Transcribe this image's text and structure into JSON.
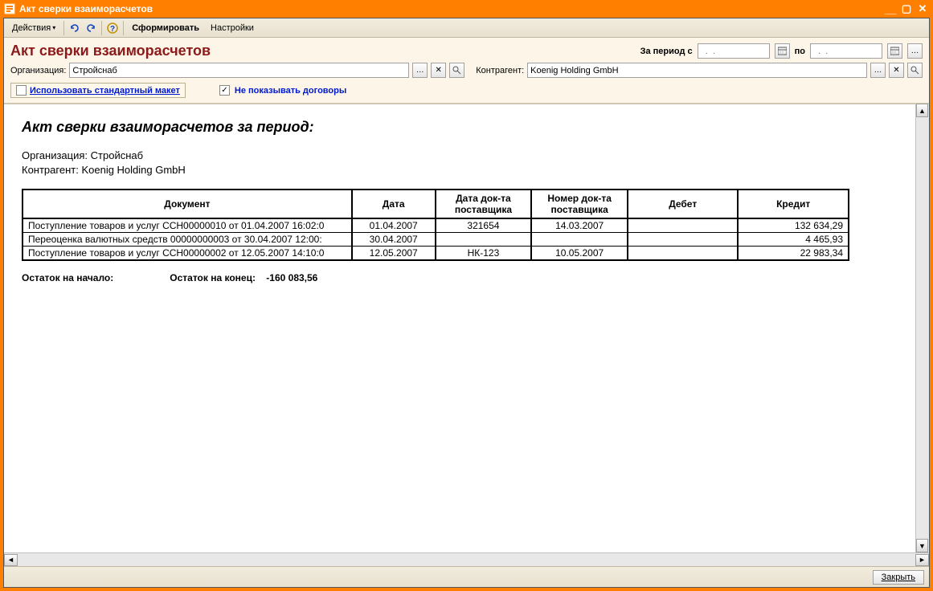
{
  "window": {
    "title": "Акт сверки взаиморасчетов"
  },
  "toolbar": {
    "actions": "Действия",
    "generate": "Сформировать",
    "settings": "Настройки"
  },
  "header": {
    "title": "Акт сверки взаиморасчетов",
    "period_label": "За период с",
    "to_label": "по",
    "date_from_placeholder": "  .  .    ",
    "date_to_placeholder": "  .  .    "
  },
  "filters": {
    "org_label": "Организация:",
    "org_value": "Стройснаб",
    "contr_label": "Контрагент:",
    "contr_value": "Koenig Holding GmbH",
    "use_std_layout_label": "Использовать стандартный макет",
    "use_std_layout_checked": false,
    "hide_contracts_label": "Не показывать договоры",
    "hide_contracts_checked": true
  },
  "report": {
    "title": "Акт сверки взаиморасчетов за период:",
    "org_line_label": "Организация:",
    "org_line_value": "Стройснаб",
    "contr_line_label": "Контрагент:",
    "contr_line_value": "Koenig Holding GmbH",
    "columns": {
      "document": "Документ",
      "date": "Дата",
      "sup_doc_date": "Дата док-та поставщика",
      "sup_doc_num": "Номер док-та поставщика",
      "debit": "Дебет",
      "credit": "Кредит"
    },
    "rows": [
      {
        "document": "Поступление товаров и услуг ССН00000010 от 01.04.2007 16:02:0",
        "date": "01.04.2007",
        "sup_date": "321654",
        "sup_num": "14.03.2007",
        "debit": "",
        "credit": "132 634,29"
      },
      {
        "document": "Переоценка валютных средств 00000000003 от 30.04.2007 12:00:",
        "date": "30.04.2007",
        "sup_date": "",
        "sup_num": "",
        "debit": "",
        "credit": "4 465,93"
      },
      {
        "document": "Поступление товаров и услуг ССН00000002 от 12.05.2007 14:10:0",
        "date": "12.05.2007",
        "sup_date": "НК-123",
        "sup_num": "10.05.2007",
        "debit": "",
        "credit": "22 983,34"
      }
    ],
    "balance_start_label": "Остаток на начало:",
    "balance_start_value": "",
    "balance_end_label": "Остаток на конец:",
    "balance_end_value": "-160 083,56"
  },
  "footer": {
    "close": "Закрыть"
  }
}
